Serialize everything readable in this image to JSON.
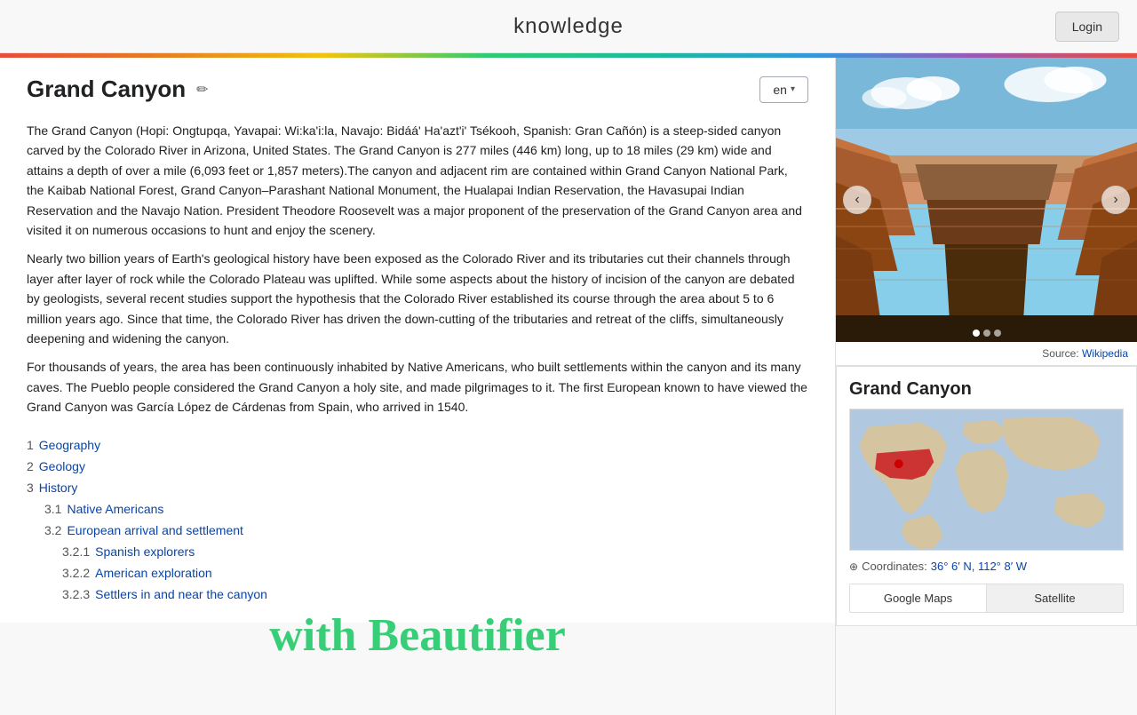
{
  "header": {
    "logo": "knowledge",
    "login_label": "Login"
  },
  "page": {
    "title": "Grand Canyon",
    "lang": "en",
    "lang_chevron": "▾"
  },
  "article": {
    "paragraphs": [
      "The Grand Canyon (Hopi: Ongtupqa, Yavapai: Wi:ka'i:la, Navajo: Bidáá' Ha'azt'i' Tsékooh, Spanish: Gran Cañón) is a steep-sided canyon carved by the Colorado River in Arizona, United States. The Grand Canyon is 277 miles (446 km) long, up to 18 miles (29 km) wide and attains a depth of over a mile (6,093 feet or 1,857 meters).The canyon and adjacent rim are contained within Grand Canyon National Park, the Kaibab National Forest, Grand Canyon–Parashant National Monument, the Hualapai Indian Reservation, the Havasupai Indian Reservation and the Navajo Nation. President Theodore Roosevelt was a major proponent of the preservation of the Grand Canyon area and visited it on numerous occasions to hunt and enjoy the scenery.",
      "Nearly two billion years of Earth's geological history have been exposed as the Colorado River and its tributaries cut their channels through layer after layer of rock while the Colorado Plateau was uplifted. While some aspects about the history of incision of the canyon are debated by geologists, several recent studies support the hypothesis that the Colorado River established its course through the area about 5 to 6 million years ago. Since that time, the Colorado River has driven the down-cutting of the tributaries and retreat of the cliffs, simultaneously deepening and widening the canyon.",
      "For thousands of years, the area has been continuously inhabited by Native Americans, who built settlements within the canyon and its many caves. The Pueblo people considered the Grand Canyon a holy site, and made pilgrimages to it. The first European known to have viewed the Grand Canyon was García López de Cárdenas from Spain, who arrived in 1540."
    ]
  },
  "toc": {
    "items": [
      {
        "number": "1",
        "label": "Geography",
        "level": 1,
        "id": "geography"
      },
      {
        "number": "2",
        "label": "Geology",
        "level": 1,
        "id": "geology"
      },
      {
        "number": "3",
        "label": "History",
        "level": 1,
        "id": "history"
      },
      {
        "number": "3.1",
        "label": "Native Americans",
        "level": 2,
        "id": "native-americans"
      },
      {
        "number": "3.2",
        "label": "European arrival and settlement",
        "level": 2,
        "id": "european-arrival"
      },
      {
        "number": "3.2.1",
        "label": "Spanish explorers",
        "level": 3,
        "id": "spanish-explorers"
      },
      {
        "number": "3.2.2",
        "label": "American exploration",
        "level": 3,
        "id": "american-exploration"
      },
      {
        "number": "3.2.3",
        "label": "Settlers in and near the canyon",
        "level": 3,
        "id": "settlers"
      }
    ]
  },
  "watermark": {
    "text": "with Beautifier"
  },
  "sidebar": {
    "source_label": "Source:",
    "source_link": "Wikipedia",
    "info_title": "Grand Canyon",
    "coordinates_label": "Coordinates:",
    "coordinates_value": "36° 6′ N, 112° 8′ W",
    "map_buttons": [
      {
        "label": "Google Maps",
        "active": true
      },
      {
        "label": "Satellite",
        "active": false
      }
    ]
  }
}
